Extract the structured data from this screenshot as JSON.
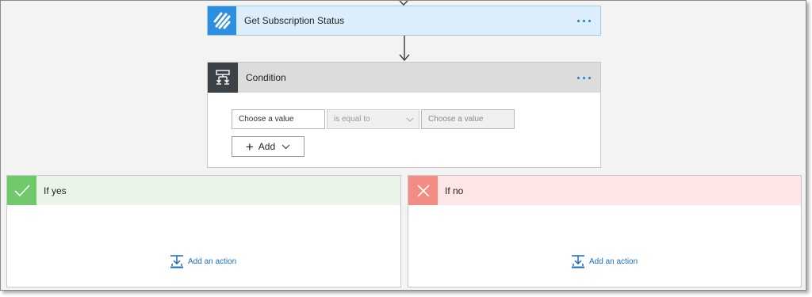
{
  "subscription_step": {
    "title": "Get Subscription Status",
    "menu_icon": "ellipsis-icon"
  },
  "condition_step": {
    "title": "Condition",
    "left_value_placeholder": "Choose a value",
    "operator": "is equal to",
    "right_value_placeholder": "Choose a value",
    "add_label": "Add"
  },
  "branches": {
    "yes": {
      "title": "If yes",
      "add_action_label": "Add an action",
      "color": "#70c96a"
    },
    "no": {
      "title": "If no",
      "add_action_label": "Add an action",
      "color": "#f38c82"
    }
  },
  "colors": {
    "accent": "#1a7fd6",
    "subscription_header": "#dceefc",
    "condition_icon_bg": "#3c4047"
  }
}
